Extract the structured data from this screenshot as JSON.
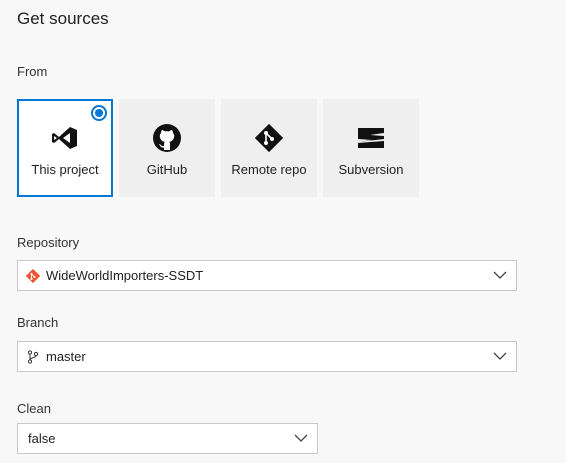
{
  "page": {
    "title": "Get sources"
  },
  "sources": {
    "label": "From",
    "tiles": [
      {
        "label": "This project",
        "icon": "visual-studio-icon",
        "selected": true
      },
      {
        "label": "GitHub",
        "icon": "github-icon",
        "selected": false
      },
      {
        "label": "Remote repo",
        "icon": "git-icon",
        "selected": false
      },
      {
        "label": "Subversion",
        "icon": "subversion-icon",
        "selected": false
      }
    ]
  },
  "repository": {
    "label": "Repository",
    "value": "WideWorldImporters-SSDT",
    "icon": "git-repo-icon"
  },
  "branch": {
    "label": "Branch",
    "value": "master",
    "icon": "branch-icon"
  },
  "clean": {
    "label": "Clean",
    "value": "false"
  },
  "colors": {
    "accent": "#0078d4",
    "git_red": "#f05133"
  }
}
